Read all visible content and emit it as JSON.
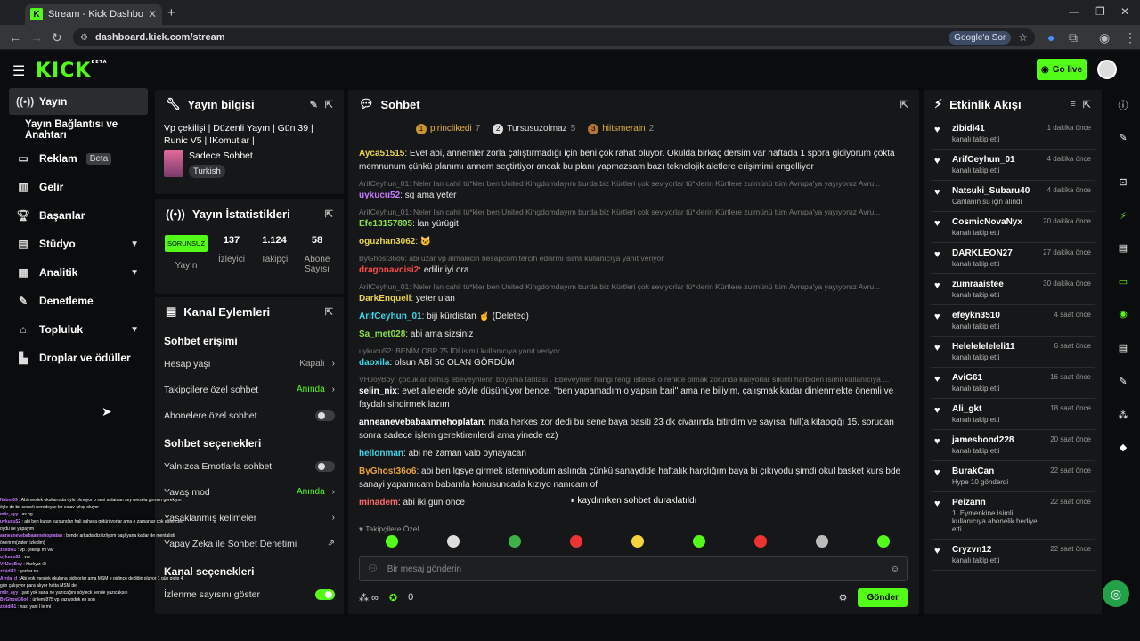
{
  "browser": {
    "tab_title": "Stream - Kick Dashboard",
    "url": "dashboard.kick.com/stream",
    "lens_label": "Google'a Sor"
  },
  "header": {
    "logo": "KICK",
    "logo_badge": "BETA",
    "go_live": "Go live"
  },
  "sidebar": {
    "items": [
      {
        "label": "Yayın",
        "icon": "broadcast-icon"
      },
      {
        "label": "Yayın Bağlantısı ve Anahtarı",
        "icon": ""
      },
      {
        "label": "Reklam",
        "icon": "ad-icon",
        "badge": "Beta"
      },
      {
        "label": "Gelir",
        "icon": "revenue-icon"
      },
      {
        "label": "Başarılar",
        "icon": "trophy-icon"
      },
      {
        "label": "Stüdyo",
        "icon": "studio-icon"
      },
      {
        "label": "Analitik",
        "icon": "analytics-icon"
      },
      {
        "label": "Denetleme",
        "icon": "wrench-icon"
      },
      {
        "label": "Topluluk",
        "icon": "community-icon"
      },
      {
        "label": "Droplar ve ödüller",
        "icon": "drops-icon"
      }
    ]
  },
  "info": {
    "title": "Yayın bilgisi",
    "stream_title": "Vp çekilişi | Düzenli Yayın | Gün 39 | Runic V5 | !Komutlar |",
    "category": "Sadece Sohbet",
    "language": "Turkish"
  },
  "stats": {
    "title": "Yayın İstatistikleri",
    "status": "SORUNSUZ",
    "status_label": "Yayın",
    "viewers": "137",
    "viewers_label": "İzleyici",
    "followers": "1.124",
    "followers_label": "Takipçi",
    "subs": "58",
    "subs_label": "Abone Sayısı"
  },
  "actions": {
    "title": "Kanal Eylemleri",
    "sec1": "Sohbet erişimi",
    "r1": "Hesap yaşı",
    "r1v": "Kapalı",
    "r2": "Takipçilere özel sohbet",
    "r2v": "Anında",
    "r3": "Abonelere özel sohbet",
    "sec2": "Sohbet seçenekleri",
    "r4": "Yalnızca Emotlarla sohbet",
    "r5": "Yavaş mod",
    "r5v": "Anında",
    "r6": "Yasaklanmış kelimeler",
    "r7": "Yapay Zeka ile Sohbet Denetimi",
    "sec3": "Kanal seçenekleri",
    "r8": "İzlenme sayısını göster"
  },
  "chat": {
    "title": "Sohbet",
    "pinned": [
      {
        "name": "pirinclikedi",
        "n": "7",
        "c": "#e8b24a"
      },
      {
        "name": "Tursusuzolmaz",
        "n": "5",
        "c": "#ddd"
      },
      {
        "name": "hiitsmerain",
        "n": "2",
        "c": "#e8b24a"
      }
    ],
    "messages": [
      {
        "reply": "",
        "user": "Ayca51515",
        "color": "#e8d44d",
        "text": "Evet abi, annemler zorla çalıştırmadığı için beni çok rahat oluyor. Okulda birkaç dersim var haftada 1 spora gidiyorum çokta memnunum çünkü planımı annem seçtirtiyor ancak bu planı yapmazsam bazı teknolojik aletlere erişimimi engelliyor"
      },
      {
        "reply": "ArifCeyhun_01: Neler lan cahil tü*kler ben United Kingdomdayım burda biz Kürtleri çok seviyorlar tü*klerin Kürtlere zulmünü tüm Avrupa'ya yayıyoruz Avru...",
        "user": "uykucu52",
        "color": "#c87bff",
        "text": "sg ama yeter"
      },
      {
        "reply": "ArifCeyhun_01: Neler lan cahil tü*kler ben United Kingdomdayım burda biz Kürtleri çok seviyorlar tü*klerin Kürtlere zulmünü tüm Avrupa'ya yayıyoruz Avru...",
        "user": "Efe13157895",
        "color": "#8be04a",
        "text": "lan yürügit"
      },
      {
        "reply": "",
        "user": "oguzhan3062",
        "color": "#e8d44d",
        "text": "🐱"
      },
      {
        "reply": "ByGhost36o6: abi uzar vp almakicin hesapcom tercih edilirmi isimli kullanıcıya yanıt veriyor",
        "user": "dragonavcisi2",
        "color": "#ff4a4a",
        "text": "edilir iyi ora"
      },
      {
        "reply": "ArifCeyhun_01: Neler lan cahil tü*kler ben United Kingdomdayım burda biz Kürtleri çok seviyorlar tü*klerin Kürtlere zulmünü tüm Avrupa'ya yayıyoruz Avru...",
        "user": "DarkEnquell",
        "color": "#e8d44d",
        "text": "yeter ulan"
      },
      {
        "reply": "",
        "user": "ArifCeyhun_01",
        "color": "#3fd4e8",
        "text": "biji kürdistan ✌ (Deleted)"
      },
      {
        "reply": "",
        "user": "Sa_met028",
        "color": "#8be04a",
        "text": "abi ama sizsiniz"
      },
      {
        "reply": "uykucu52: BENİM OBP 75 İDİ isimli kullanıcıya yanıt veriyor",
        "user": "daoxila",
        "color": "#3fd4e8",
        "text": "olsun ABİ 50 OLAN GÖRDÜM"
      },
      {
        "reply": "VHJoyBoy: çocuklar olmuş ebeveynlerin boyama tahtası . Ebeveynler hangi rengi isterse o renkte olmak zorunda kalıyorlar sıkıntı harbiden isimli kullanıcıya ...",
        "user": "selin_nix",
        "color": "#fff",
        "text": "evet ailelerde şöyle düşünüyor bence. ''ben yapamadım o yapsın bari'' ama ne biliyim, çalışmak kadar dinlenmekte önemli ve faydalı sindirmek lazım"
      },
      {
        "reply": "",
        "user": "anneanevebabaannehoplatan",
        "color": "#fff",
        "text": "mata herkes zor dedi bu sene baya basiti 23 dk civarında bitirdim ve sayısal full(a kitapçığı 15. sorudan sonra sadece işlem gerektirenlerdi ama yinede ez)"
      },
      {
        "reply": "",
        "user": "hellonman",
        "color": "#3fd4e8",
        "text": "abi ne zaman valo oynayacan"
      },
      {
        "reply": "",
        "user": "ByGhost36o6",
        "color": "#e8a33c",
        "text": "abi ben lgsye girmek istemiyodum aslında çünkü sanaydide haftalık harçlığım baya bi çıkıyodu şimdi okul basket kurs bde sanayi yapamıcam babamla konusuncada kızıyo nanıcam of"
      },
      {
        "reply": "",
        "user": "minadem",
        "color": "#ff6b6b",
        "text": "abi iki gün önce"
      }
    ],
    "paused": "kaydırırken sohbet duraklatıldı",
    "emote_label": "Takipçilere Özel",
    "placeholder": "Bir mesaj gönderin",
    "count": "0",
    "send": "Gönder"
  },
  "activity": {
    "title": "Etkinlik Akışı",
    "events": [
      {
        "name": "zibidi41",
        "sub": "kanalı takip etti",
        "time": "1 dakika önce"
      },
      {
        "name": "ArifCeyhun_01",
        "sub": "kanalı takip etti",
        "time": "4 dakika önce"
      },
      {
        "name": "Natsuki_Subaru40",
        "sub": "Canlanın su için alındı",
        "time": "4 dakika önce"
      },
      {
        "name": "CosmicNovaNyx",
        "sub": "kanalı takip etti",
        "time": "20 dakika önce"
      },
      {
        "name": "DARKLEON27",
        "sub": "kanalı takip etti",
        "time": "27 dakika önce"
      },
      {
        "name": "zumraaistee",
        "sub": "kanalı takip etti",
        "time": "30 dakika önce"
      },
      {
        "name": "efeykn3510",
        "sub": "kanalı takip etti",
        "time": "4 saat önce"
      },
      {
        "name": "Heleleleleleli11",
        "sub": "kanalı takip etti",
        "time": "6 saat önce"
      },
      {
        "name": "AviG61",
        "sub": "kanalı takip etti",
        "time": "16 saat önce"
      },
      {
        "name": "Ali_gkt",
        "sub": "kanalı takip etti",
        "time": "18 saat önce"
      },
      {
        "name": "jamesbond228",
        "sub": "kanalı takip etti",
        "time": "20 saat önce"
      },
      {
        "name": "BurakCan",
        "sub": "Hype 10 gönderdi",
        "time": "22 saat önce"
      },
      {
        "name": "Peizann",
        "sub": "1, Eymenkine isimli kullanıcıya abonelik hediye etti.",
        "time": "22 saat önce"
      },
      {
        "name": "Cryzvn12",
        "sub": "kanalı takip etti",
        "time": "22 saat önce"
      }
    ]
  },
  "overlay": [
    {
      "u": "Naber69",
      "t": "Abi meslek okullarında öyle olmuyor o seni anlatılan şey mesela girmen gerekiyor öyle de bir sınavlı neredeyse bir sınav çıkıp oluyor"
    },
    {
      "u": "mlir_ayy",
      "t": "as hg"
    },
    {
      "u": "uykucu52",
      "t": "abi ben kuran kursundan hali sahaya götürüyorlar ama o zamanlar çok eğlenceli oydu ne yapayım"
    },
    {
      "u": "anneanevebabaannehoplatan",
      "t": "bende arkada dizi izliyom başlıyana kadar de mentalisti öneririm(zaten izledim)"
    },
    {
      "u": "zibidi41",
      "t": "vp .çekilişi mi var"
    },
    {
      "u": "uykucu52",
      "t": "var"
    },
    {
      "u": "VHJoyBoy",
      "t": "Hızlıyız :D"
    },
    {
      "u": "zibidi41",
      "t": "şartlar ne"
    },
    {
      "u": "Arrda_d",
      "t": "Abi yok meslek okuluna gidiyorlar ama MSM e gidince dediğin oluyor 1 gün gidip 4 gün çalışıyor para alıyor hatta MSM de"
    },
    {
      "u": "mlir_ayy",
      "t": "şart yok sana ne yazıcağını söyleck sende yazıcaksın"
    },
    {
      "u": "ByGhost36o6",
      "t": "ünlem 875 vp yazıyoduk en son"
    },
    {
      "u": "zibidi41",
      "t": "nası yani l le mi"
    }
  ]
}
